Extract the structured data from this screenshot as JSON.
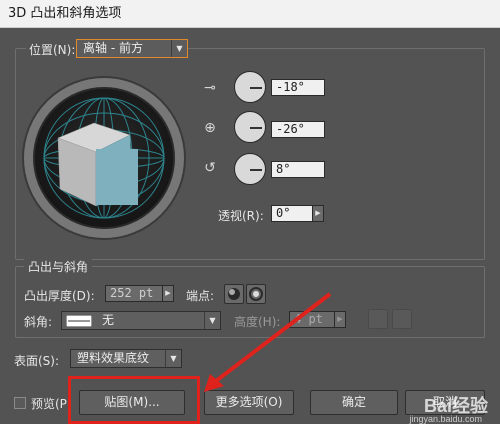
{
  "window": {
    "title": "3D 凸出和斜角选项"
  },
  "position": {
    "label": "位置(N):",
    "preset": "离轴 - 前方",
    "x_rotation": "-18°",
    "y_rotation": "-26°",
    "z_rotation": "8°",
    "perspective_label": "透视(R):",
    "perspective": "0°"
  },
  "extrude": {
    "group_title": "凸出与斜角",
    "depth_label": "凸出厚度(D):",
    "depth": "252 pt",
    "cap_label": "端点:",
    "bevel_label": "斜角:",
    "bevel": "无",
    "height_label": "高度(H):",
    "height": "4 pt"
  },
  "surface": {
    "label": "表面(S):",
    "value": "塑料效果底纹"
  },
  "buttons": {
    "preview_label": "预览(P)",
    "map": "贴图(M)...",
    "more_options": "更多选项(O)",
    "ok": "确定",
    "cancel": "取消"
  },
  "watermark": {
    "brand": "Bai经验",
    "url": "jingyan.baidu.com"
  },
  "colors": {
    "cube_front": "#7fb0be",
    "cube_top": "#d7d7d7",
    "cube_side": "#b9b9b9",
    "highlight": "#e0221c",
    "accent_orange": "#e08a2c"
  }
}
